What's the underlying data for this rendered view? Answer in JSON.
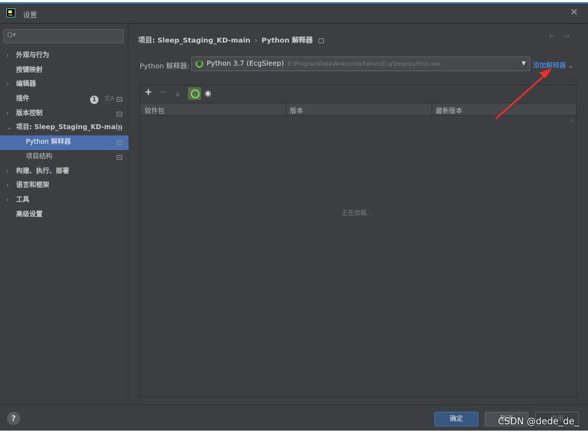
{
  "window": {
    "title": "设置"
  },
  "search": {
    "placeholder": ""
  },
  "sidebar": {
    "items": [
      {
        "label": "外观与行为",
        "arrow": "›"
      },
      {
        "label": "按键映射",
        "arrow": ""
      },
      {
        "label": "编辑器",
        "arrow": "›"
      },
      {
        "label": "插件",
        "arrow": "",
        "badge": "1"
      },
      {
        "label": "版本控制",
        "arrow": "›"
      },
      {
        "label": "项目: Sleep_Staging_KD-main",
        "arrow": "⌄"
      },
      {
        "label": "Python 解释器",
        "arrow": ""
      },
      {
        "label": "项目结构",
        "arrow": ""
      },
      {
        "label": "构建、执行、部署",
        "arrow": "›"
      },
      {
        "label": "语言和框架",
        "arrow": "›"
      },
      {
        "label": "工具",
        "arrow": "›"
      },
      {
        "label": "高级设置",
        "arrow": ""
      }
    ]
  },
  "breadcrumb": {
    "project": "项目: Sleep_Staging_KD-main",
    "separator": "›",
    "page": "Python 解释器"
  },
  "interpreter": {
    "label": "Python 解释器:",
    "name": "Python 3.7 (EcgSleep)",
    "path": "E:\\ProgramData\\Anaconda3\\envs\\EcgSleep\\python.exe",
    "add_label": "添加解释器"
  },
  "packages": {
    "columns": [
      "软件包",
      "版本",
      "最新版本"
    ],
    "loading_text": "正在加载..."
  },
  "footer": {
    "ok_label": "确定",
    "cancel_label": "取消",
    "apply_label": "应用",
    "watermark": "CSDN @dede_de_"
  },
  "colors": {
    "accent": "#4b6eaf",
    "link": "#589df6",
    "annotation_arrow": "#ff2a2a"
  }
}
